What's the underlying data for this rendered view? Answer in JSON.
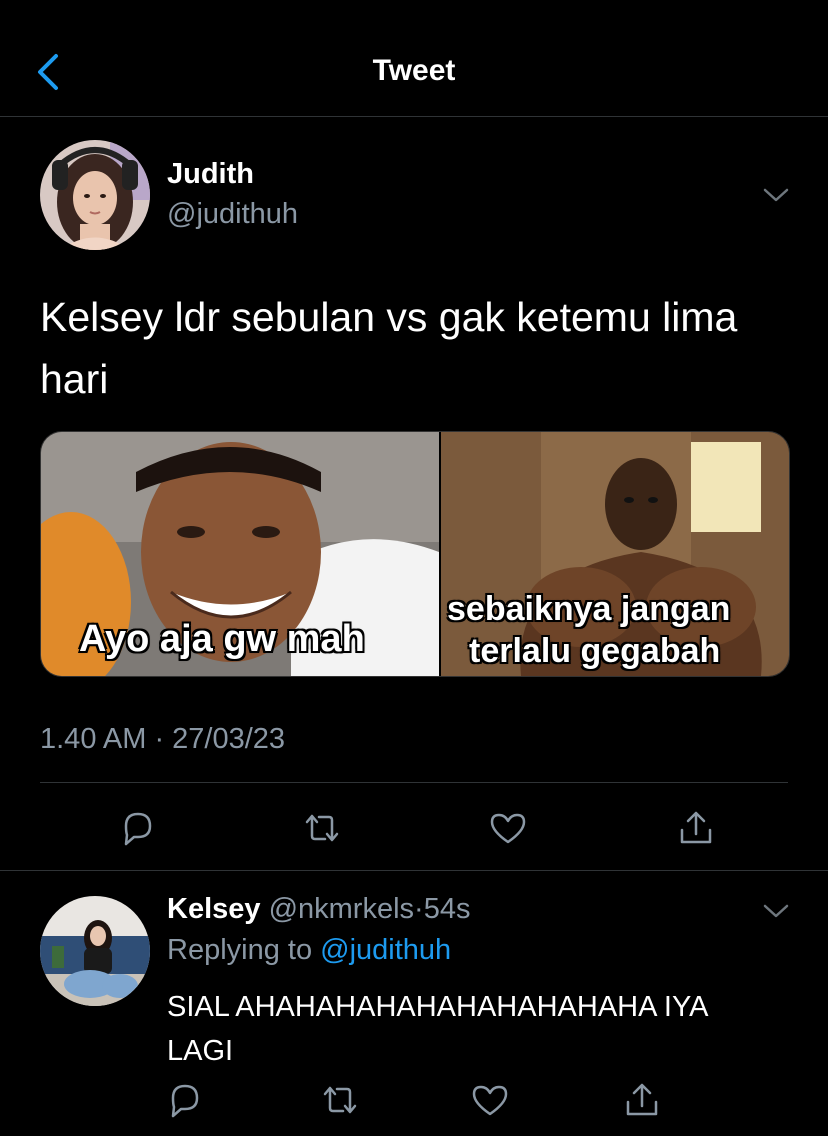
{
  "header": {
    "title": "Tweet"
  },
  "tweet": {
    "author_name": "Judith",
    "author_handle": "@judithuh",
    "text": "Kelsey ldr sebulan vs gak ketemu lima hari",
    "media": {
      "left_caption": "Ayo aja gw mah",
      "right_caption_line1": "sebaiknya jangan",
      "right_caption_line2": "terlalu gegabah"
    },
    "timestamp": "1.40 AM · 27/03/23"
  },
  "reply": {
    "author_name": "Kelsey",
    "author_handle": "@nkmrkels",
    "separator": "·",
    "time": "54s",
    "replying_prefix": "Replying to",
    "replying_handle": "@judithuh",
    "text": "SIAL AHAHAHAHAHAHAHAHAHAHA IYA LAGI"
  },
  "icons": [
    "back-chevron-icon",
    "chevron-down-icon",
    "reply-icon",
    "retweet-icon",
    "like-icon",
    "share-icon"
  ],
  "colors": {
    "background": "#000000",
    "secondary_text": "#8b98a5",
    "link": "#1d9bf0",
    "accent": "#1d9bf0",
    "divider": "#2f3336"
  }
}
